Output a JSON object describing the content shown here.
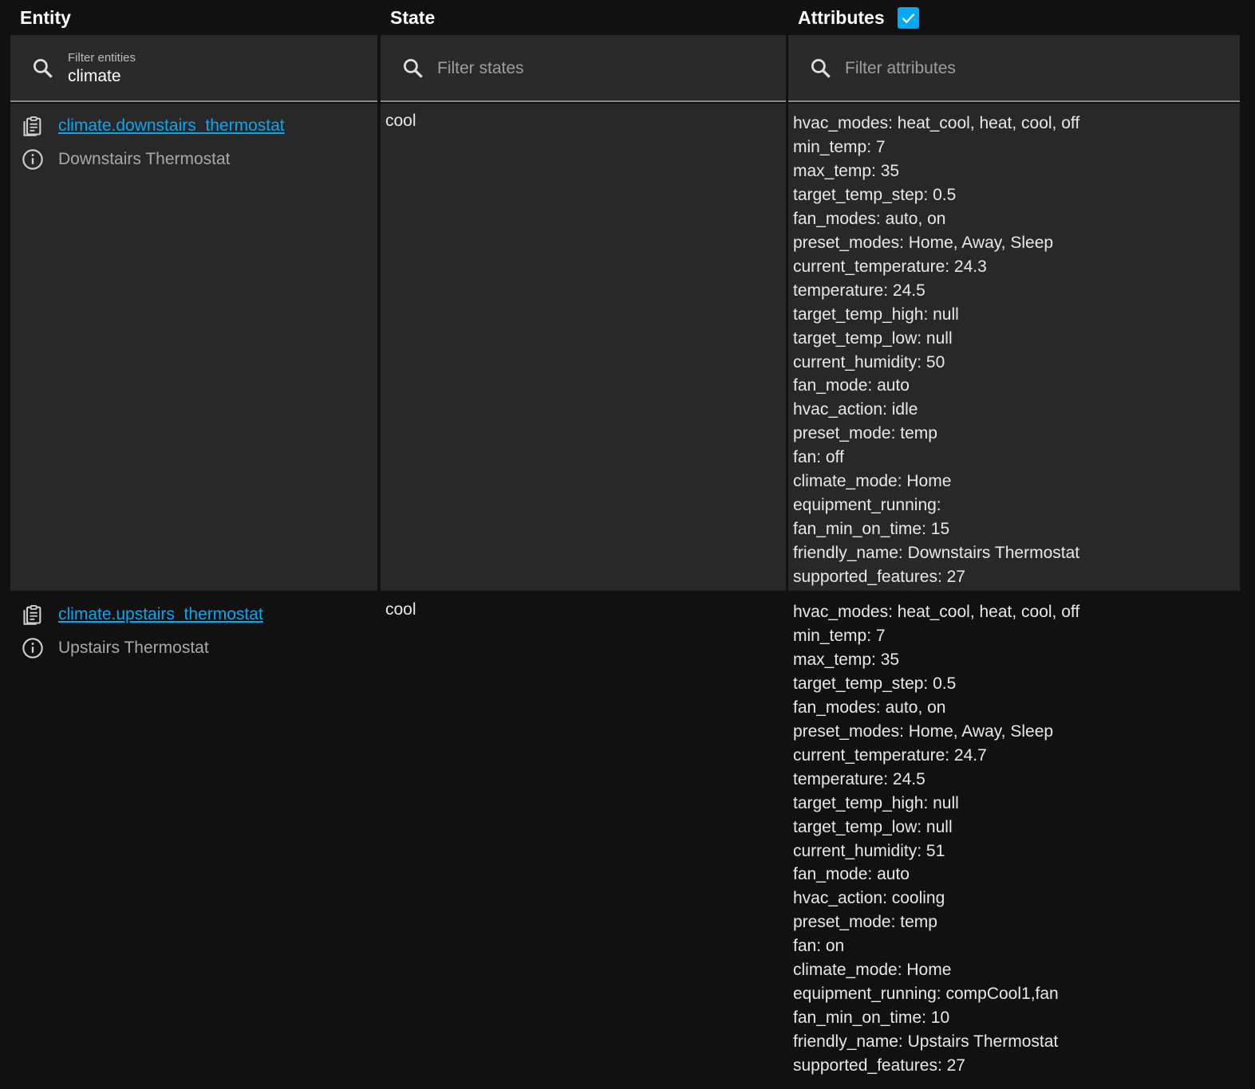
{
  "header": {
    "entity_label": "Entity",
    "state_label": "State",
    "attributes_label": "Attributes",
    "attributes_checked": true
  },
  "filters": {
    "entities": {
      "label": "Filter entities",
      "value": "climate"
    },
    "states": {
      "placeholder": "Filter states"
    },
    "attributes": {
      "placeholder": "Filter attributes"
    }
  },
  "colors": {
    "accent": "#03a9f4",
    "background": "#111111",
    "row_highlight": "#282828"
  },
  "rows": [
    {
      "entity_id": "climate.downstairs_thermostat",
      "friendly_name": "Downstairs Thermostat",
      "state": "cool",
      "attributes": [
        "hvac_modes: heat_cool, heat, cool, off",
        "min_temp: 7",
        "max_temp: 35",
        "target_temp_step: 0.5",
        "fan_modes: auto, on",
        "preset_modes: Home, Away, Sleep",
        "current_temperature: 24.3",
        "temperature: 24.5",
        "target_temp_high: null",
        "target_temp_low: null",
        "current_humidity: 50",
        "fan_mode: auto",
        "hvac_action: idle",
        "preset_mode: temp",
        "fan: off",
        "climate_mode: Home",
        "equipment_running: ",
        "fan_min_on_time: 15",
        "friendly_name: Downstairs Thermostat",
        "supported_features: 27"
      ]
    },
    {
      "entity_id": "climate.upstairs_thermostat",
      "friendly_name": "Upstairs Thermostat",
      "state": "cool",
      "attributes": [
        "hvac_modes: heat_cool, heat, cool, off",
        "min_temp: 7",
        "max_temp: 35",
        "target_temp_step: 0.5",
        "fan_modes: auto, on",
        "preset_modes: Home, Away, Sleep",
        "current_temperature: 24.7",
        "temperature: 24.5",
        "target_temp_high: null",
        "target_temp_low: null",
        "current_humidity: 51",
        "fan_mode: auto",
        "hvac_action: cooling",
        "preset_mode: temp",
        "fan: on",
        "climate_mode: Home",
        "equipment_running: compCool1,fan",
        "fan_min_on_time: 10",
        "friendly_name: Upstairs Thermostat",
        "supported_features: 27"
      ]
    }
  ]
}
